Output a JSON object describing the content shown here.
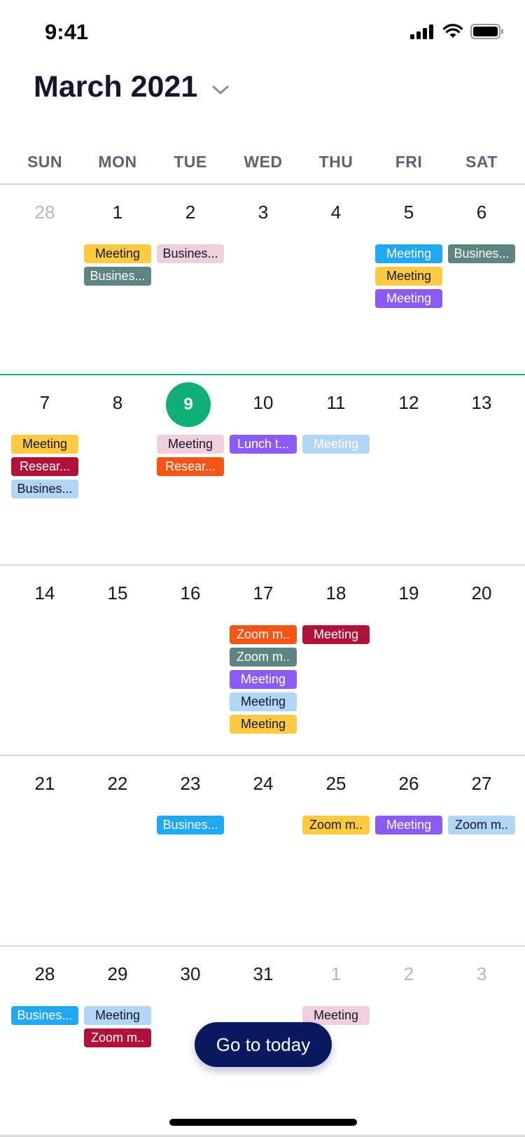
{
  "status_bar": {
    "time": "9:41",
    "icons": [
      "signal-icon",
      "wifi-icon",
      "battery-icon"
    ]
  },
  "header": {
    "title": "March 2021",
    "dropdown_icon": "chevron-down-icon"
  },
  "weekdays": [
    "SUN",
    "MON",
    "TUE",
    "WED",
    "THU",
    "FRI",
    "SAT"
  ],
  "today": {
    "day": "9"
  },
  "colors": {
    "accent_green": "#0fae77",
    "button_navy": "#0a1a5e",
    "yellow": "#ffc940",
    "slate": "#5d8481",
    "pink": "#f0cfdc",
    "blue": "#1fa7f2",
    "purple": "#8a5cf5",
    "crimson": "#b0123a",
    "orange": "#f55414",
    "light_blue": "#b0d5f5"
  },
  "weeks": [
    {
      "days": [
        {
          "num": "28",
          "muted": true,
          "events": []
        },
        {
          "num": "1",
          "events": [
            {
              "label": "Meeting",
              "bg": "#ffc940",
              "fg": "#14162b"
            },
            {
              "label": "Busines...",
              "bg": "#5d8481",
              "fg": "#ffffff"
            }
          ]
        },
        {
          "num": "2",
          "events": [
            {
              "label": "Busines...",
              "bg": "#f0cfdc",
              "fg": "#14162b"
            }
          ]
        },
        {
          "num": "3",
          "events": []
        },
        {
          "num": "4",
          "events": []
        },
        {
          "num": "5",
          "events": [
            {
              "label": "Meeting",
              "bg": "#1fa7f2",
              "fg": "#ffffff"
            },
            {
              "label": "Meeting",
              "bg": "#ffc940",
              "fg": "#14162b"
            },
            {
              "label": "Meeting",
              "bg": "#8a5cf5",
              "fg": "#ffffff"
            }
          ]
        },
        {
          "num": "6",
          "events": [
            {
              "label": "Busines...",
              "bg": "#5d8481",
              "fg": "#ffffff"
            }
          ]
        }
      ]
    },
    {
      "current": true,
      "days": [
        {
          "num": "7",
          "events": [
            {
              "label": "Meeting",
              "bg": "#ffc940",
              "fg": "#14162b"
            },
            {
              "label": "Resear...",
              "bg": "#b0123a",
              "fg": "#ffffff"
            },
            {
              "label": "Busines...",
              "bg": "#b0d5f5",
              "fg": "#14162b"
            }
          ]
        },
        {
          "num": "8",
          "events": []
        },
        {
          "num": "9",
          "today": true,
          "events": [
            {
              "label": "Meeting",
              "bg": "#f0cfdc",
              "fg": "#14162b"
            },
            {
              "label": "Resear...",
              "bg": "#f55414",
              "fg": "#ffffff"
            }
          ]
        },
        {
          "num": "10",
          "events": [
            {
              "label": "Lunch t...",
              "bg": "#8a5cf5",
              "fg": "#ffffff"
            }
          ]
        },
        {
          "num": "11",
          "events": [
            {
              "label": "Meeting",
              "bg": "#b0d5f5",
              "fg": "#ffffff"
            }
          ]
        },
        {
          "num": "12",
          "events": []
        },
        {
          "num": "13",
          "events": []
        }
      ]
    },
    {
      "days": [
        {
          "num": "14",
          "events": []
        },
        {
          "num": "15",
          "events": []
        },
        {
          "num": "16",
          "events": []
        },
        {
          "num": "17",
          "events": [
            {
              "label": "Zoom m..",
              "bg": "#f55414",
              "fg": "#ffffff"
            },
            {
              "label": "Zoom m..",
              "bg": "#5d8481",
              "fg": "#ffffff"
            },
            {
              "label": "Meeting",
              "bg": "#8a5cf5",
              "fg": "#ffffff"
            },
            {
              "label": "Meeting",
              "bg": "#b0d5f5",
              "fg": "#14162b"
            },
            {
              "label": "Meeting",
              "bg": "#ffc940",
              "fg": "#14162b"
            }
          ]
        },
        {
          "num": "18",
          "events": [
            {
              "label": "Meeting",
              "bg": "#b0123a",
              "fg": "#ffffff"
            }
          ]
        },
        {
          "num": "19",
          "events": []
        },
        {
          "num": "20",
          "events": []
        }
      ]
    },
    {
      "days": [
        {
          "num": "21",
          "events": []
        },
        {
          "num": "22",
          "events": []
        },
        {
          "num": "23",
          "events": [
            {
              "label": "Busines...",
              "bg": "#1fa7f2",
              "fg": "#ffffff"
            }
          ]
        },
        {
          "num": "24",
          "events": []
        },
        {
          "num": "25",
          "events": [
            {
              "label": "Zoom m..",
              "bg": "#ffc940",
              "fg": "#14162b"
            }
          ]
        },
        {
          "num": "26",
          "events": [
            {
              "label": "Meeting",
              "bg": "#8a5cf5",
              "fg": "#ffffff"
            }
          ]
        },
        {
          "num": "27",
          "events": [
            {
              "label": "Zoom m..",
              "bg": "#b0d5f5",
              "fg": "#14162b"
            }
          ]
        }
      ]
    },
    {
      "days": [
        {
          "num": "28",
          "events": [
            {
              "label": "Busines...",
              "bg": "#1fa7f2",
              "fg": "#ffffff"
            }
          ]
        },
        {
          "num": "29",
          "events": [
            {
              "label": "Meeting",
              "bg": "#b0d5f5",
              "fg": "#14162b"
            },
            {
              "label": "Zoom m..",
              "bg": "#b0123a",
              "fg": "#ffffff"
            }
          ]
        },
        {
          "num": "30",
          "events": []
        },
        {
          "num": "31",
          "events": []
        },
        {
          "num": "1",
          "muted": true,
          "events": [
            {
              "label": "Meeting",
              "bg": "#f0cfdc",
              "fg": "#14162b"
            }
          ]
        },
        {
          "num": "2",
          "muted": true,
          "events": []
        },
        {
          "num": "3",
          "muted": true,
          "events": []
        }
      ]
    }
  ],
  "go_today": {
    "label": "Go to today"
  }
}
